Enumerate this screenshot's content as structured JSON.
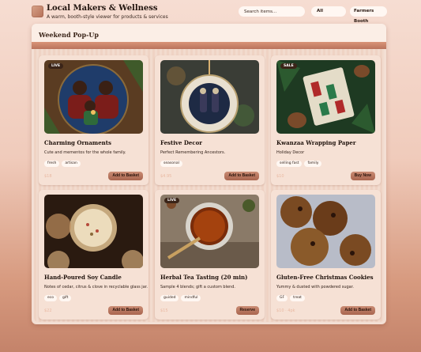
{
  "header": {
    "title": "Local Makers & Wellness",
    "subtitle": "A warm, booth-style viewer for products & services",
    "search_placeholder": "Search items...",
    "category_value": "All",
    "booth_label": "Farmers Booth"
  },
  "section": {
    "title": "Weekend Pop-Up"
  },
  "cards": [
    {
      "badge": "LIVE",
      "name": "Charming Ornaments",
      "desc": "Cute and mementos for the whole family.",
      "tags": [
        "fresh",
        "artisan"
      ],
      "price": "$18",
      "action": "Add to Basket"
    },
    {
      "badge": "",
      "name": "Festive Decor",
      "desc": "Perfect Remembering Ancestors.",
      "tags": [
        "seasonal"
      ],
      "price": "$4.95",
      "action": "Add to Basket"
    },
    {
      "badge": "SALE",
      "name": "Kwanzaa Wrapping Paper",
      "desc": "Holiday Decor",
      "tags": [
        "selling fast",
        "family"
      ],
      "price": "$10",
      "action": "Buy Now"
    },
    {
      "badge": "",
      "name": "Hand-Poured Soy Candle",
      "desc": "Notes of cedar, citrus & clove in recyclable glass jar.",
      "tags": [
        "eco",
        "gift"
      ],
      "price": "$22",
      "action": "Add to Basket"
    },
    {
      "badge": "LIVE",
      "name": "Herbal Tea Tasting (20 min)",
      "desc": "Sample 4 blends; gift a custom blend.",
      "tags": [
        "guided",
        "mindful"
      ],
      "price": "$15",
      "action": "Reserve"
    },
    {
      "badge": "",
      "name": "Gluten-Free Christmas Cookies",
      "desc": "Yummy & dusted with powdered sugar.",
      "tags": [
        "GF",
        "treat"
      ],
      "price": "$10 · 4pk",
      "action": "Add to Basket"
    }
  ]
}
